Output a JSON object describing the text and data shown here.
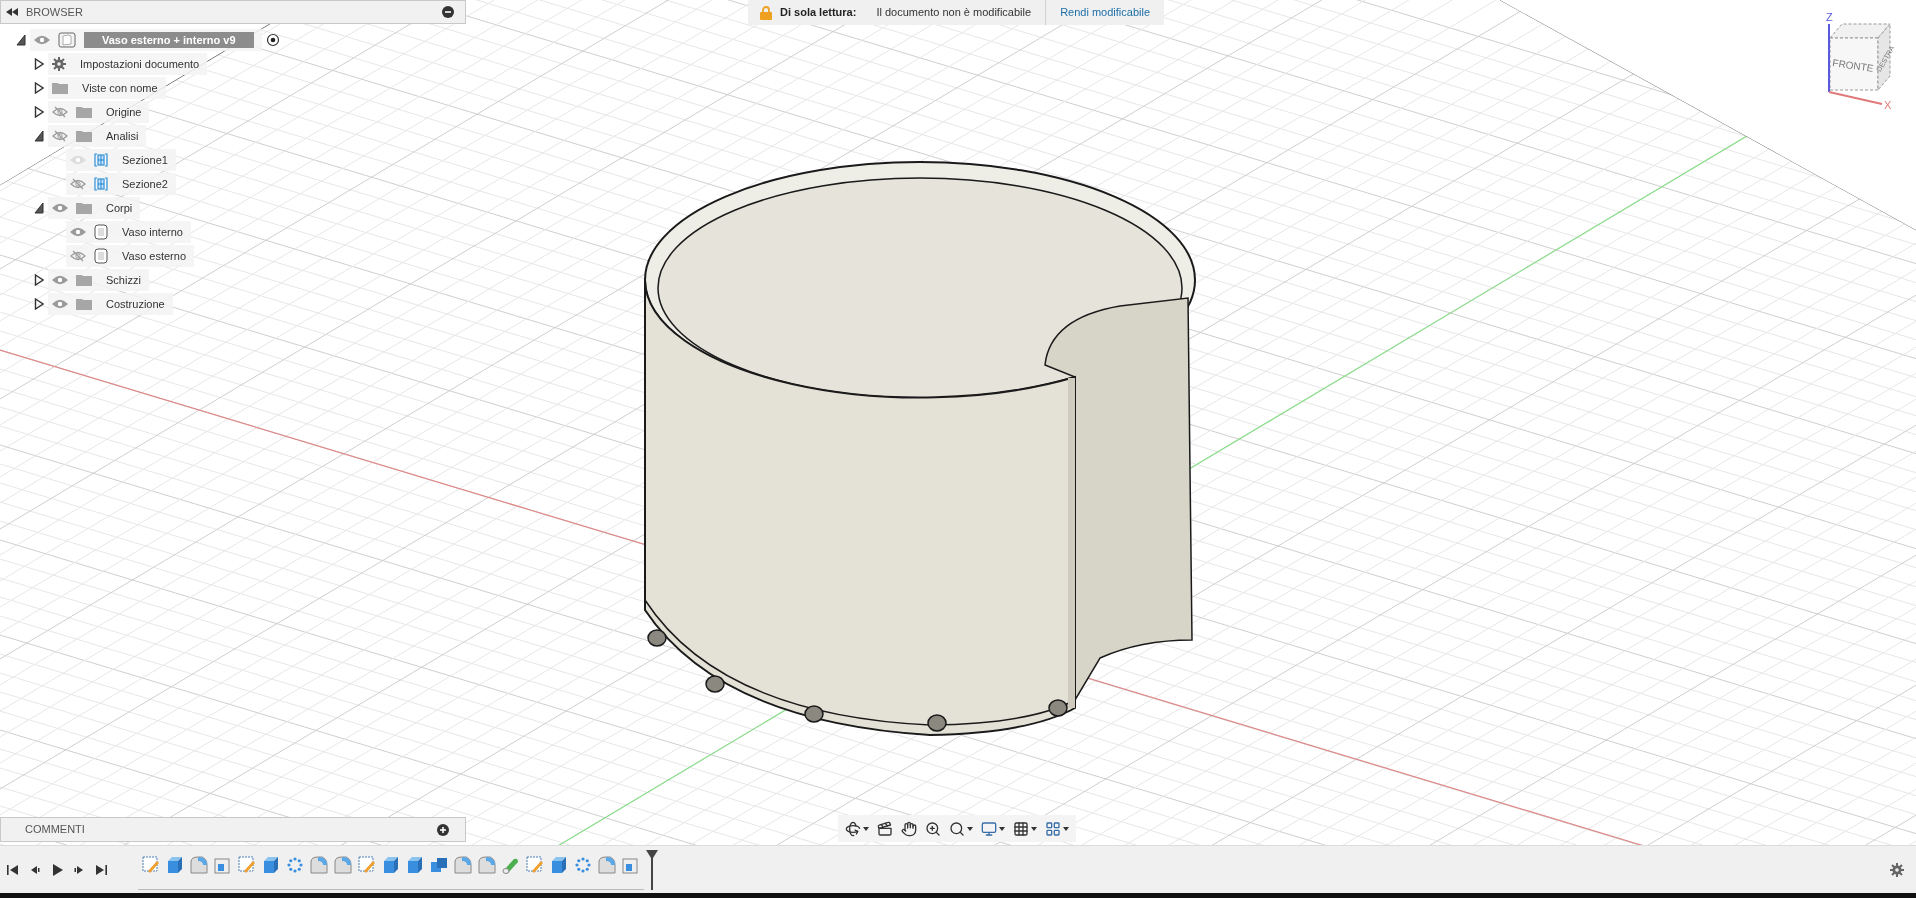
{
  "browser": {
    "title": "BROWSER",
    "tree": [
      {
        "label": "Vaso esterno + interno v9",
        "kind": "component",
        "visible": true,
        "dimmed": false,
        "expanded": true,
        "active": true,
        "children": [
          {
            "label": "Impostazioni documento",
            "kind": "settings",
            "expanded": false
          },
          {
            "label": "Viste con nome",
            "kind": "folder",
            "expanded": false
          },
          {
            "label": "Origine",
            "kind": "folder",
            "visible": false,
            "dimmed": false,
            "expanded": false
          },
          {
            "label": "Analisi",
            "kind": "folder",
            "visible": false,
            "dimmed": false,
            "expanded": true,
            "children": [
              {
                "label": "Sezione1",
                "kind": "section",
                "visible": true,
                "dimmed": true
              },
              {
                "label": "Sezione2",
                "kind": "section",
                "visible": false,
                "dimmed": false
              }
            ]
          },
          {
            "label": "Corpi",
            "kind": "folder",
            "visible": true,
            "dimmed": false,
            "expanded": true,
            "children": [
              {
                "label": "Vaso interno",
                "kind": "body",
                "visible": true,
                "dimmed": false
              },
              {
                "label": "Vaso esterno",
                "kind": "body",
                "visible": false,
                "dimmed": false
              }
            ]
          },
          {
            "label": "Schizzi",
            "kind": "folder",
            "visible": true,
            "dimmed": false,
            "expanded": false
          },
          {
            "label": "Costruzione",
            "kind": "folder",
            "visible": true,
            "dimmed": false,
            "expanded": false
          }
        ]
      }
    ]
  },
  "banner": {
    "label": "Di sola lettura:",
    "message": "Il documento non è modificabile",
    "action": "Rendi modificabile"
  },
  "viewcube": {
    "front": "FRONTE",
    "right": "DESTRA",
    "axis_z": "Z",
    "axis_x": "X"
  },
  "comments": {
    "title": "COMMENTI"
  }
}
